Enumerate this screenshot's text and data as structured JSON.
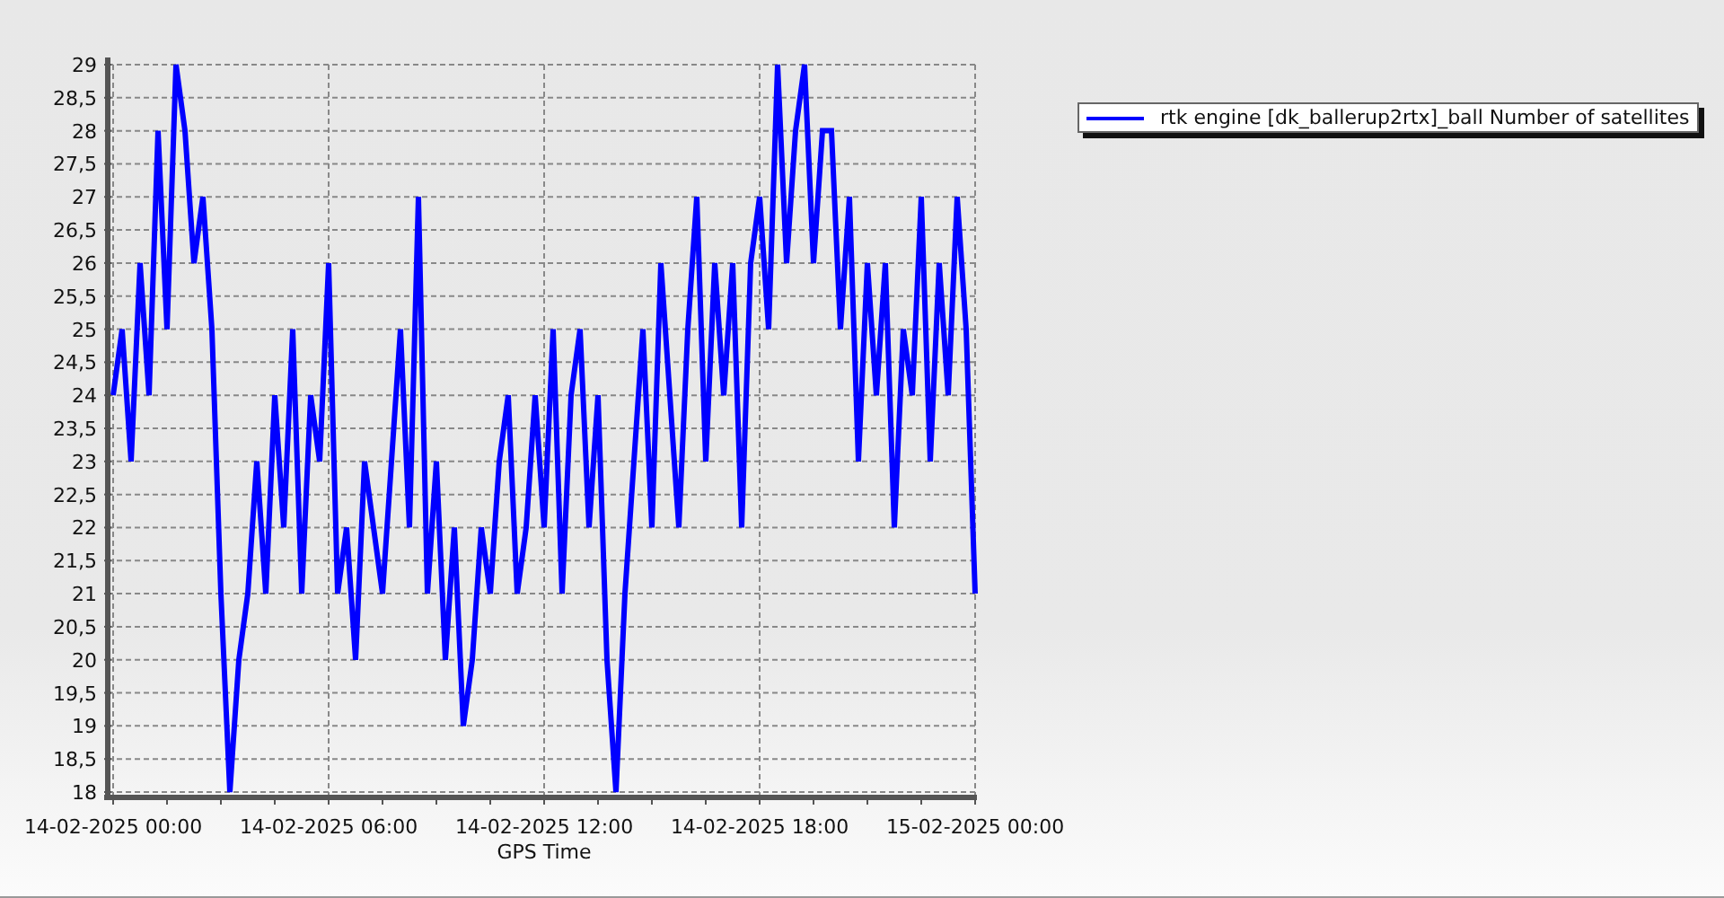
{
  "chart_data": {
    "type": "line",
    "grid": true,
    "xlabel": "GPS Time",
    "ylim": [
      18,
      29
    ],
    "categories": [
      "14-02-2025 00:00",
      null,
      null,
      null,
      null,
      null,
      null,
      null,
      null,
      null,
      null,
      null,
      null,
      null,
      null,
      null,
      null,
      null,
      null,
      null,
      null,
      null,
      null,
      null,
      "14-02-2025 06:00",
      null,
      null,
      null,
      null,
      null,
      null,
      null,
      null,
      null,
      null,
      null,
      null,
      null,
      null,
      null,
      null,
      null,
      null,
      null,
      null,
      null,
      null,
      null,
      "14-02-2025 12:00",
      null,
      null,
      null,
      null,
      null,
      null,
      null,
      null,
      null,
      null,
      null,
      null,
      null,
      null,
      null,
      null,
      null,
      null,
      null,
      null,
      null,
      null,
      null,
      "14-02-2025 18:00",
      null,
      null,
      null,
      null,
      null,
      null,
      null,
      null,
      null,
      null,
      null,
      null,
      null,
      null,
      null,
      null,
      null,
      null,
      null,
      null,
      null,
      null,
      null,
      "15-02-2025 00:00"
    ],
    "yticks": [
      18,
      {
        "value": 18.5,
        "label": "18,5"
      },
      19,
      {
        "value": 19.5,
        "label": "19,5"
      },
      20,
      {
        "value": 20.5,
        "label": "20,5"
      },
      21,
      {
        "value": 21.5,
        "label": "21,5"
      },
      22,
      {
        "value": 22.5,
        "label": "22,5"
      },
      23,
      {
        "value": 23.5,
        "label": "23,5"
      },
      24,
      {
        "value": 24.5,
        "label": "24,5"
      },
      25,
      {
        "value": 25.5,
        "label": "25,5"
      },
      26,
      {
        "value": 26.5,
        "label": "26,5"
      },
      27,
      {
        "value": 27.5,
        "label": "27,5"
      },
      28,
      {
        "value": 28.5,
        "label": "28,5"
      },
      29
    ],
    "series": [
      {
        "name": "rtk engine [dk_ballerup2rtx]_ball Number of satellites",
        "color": "#0000ff",
        "values": [
          24,
          25,
          23,
          26,
          24,
          28,
          25,
          29,
          28,
          26,
          27,
          25,
          21,
          18,
          20,
          21,
          23,
          21,
          24,
          22,
          25,
          21,
          24,
          23,
          26,
          21,
          22,
          20,
          23,
          22,
          21,
          23,
          25,
          22,
          27,
          21,
          23,
          20,
          22,
          19,
          20,
          22,
          21,
          23,
          24,
          21,
          22,
          24,
          22,
          25,
          21,
          24,
          25,
          22,
          24,
          20,
          18,
          21,
          23,
          25,
          22,
          26,
          24,
          22,
          25,
          27,
          23,
          26,
          24,
          26,
          22,
          26,
          27,
          25,
          29,
          26,
          28,
          29,
          26,
          28,
          28,
          25,
          27,
          23,
          26,
          24,
          26,
          22,
          25,
          24,
          27,
          23,
          26,
          24,
          27,
          25,
          21
        ]
      }
    ]
  }
}
